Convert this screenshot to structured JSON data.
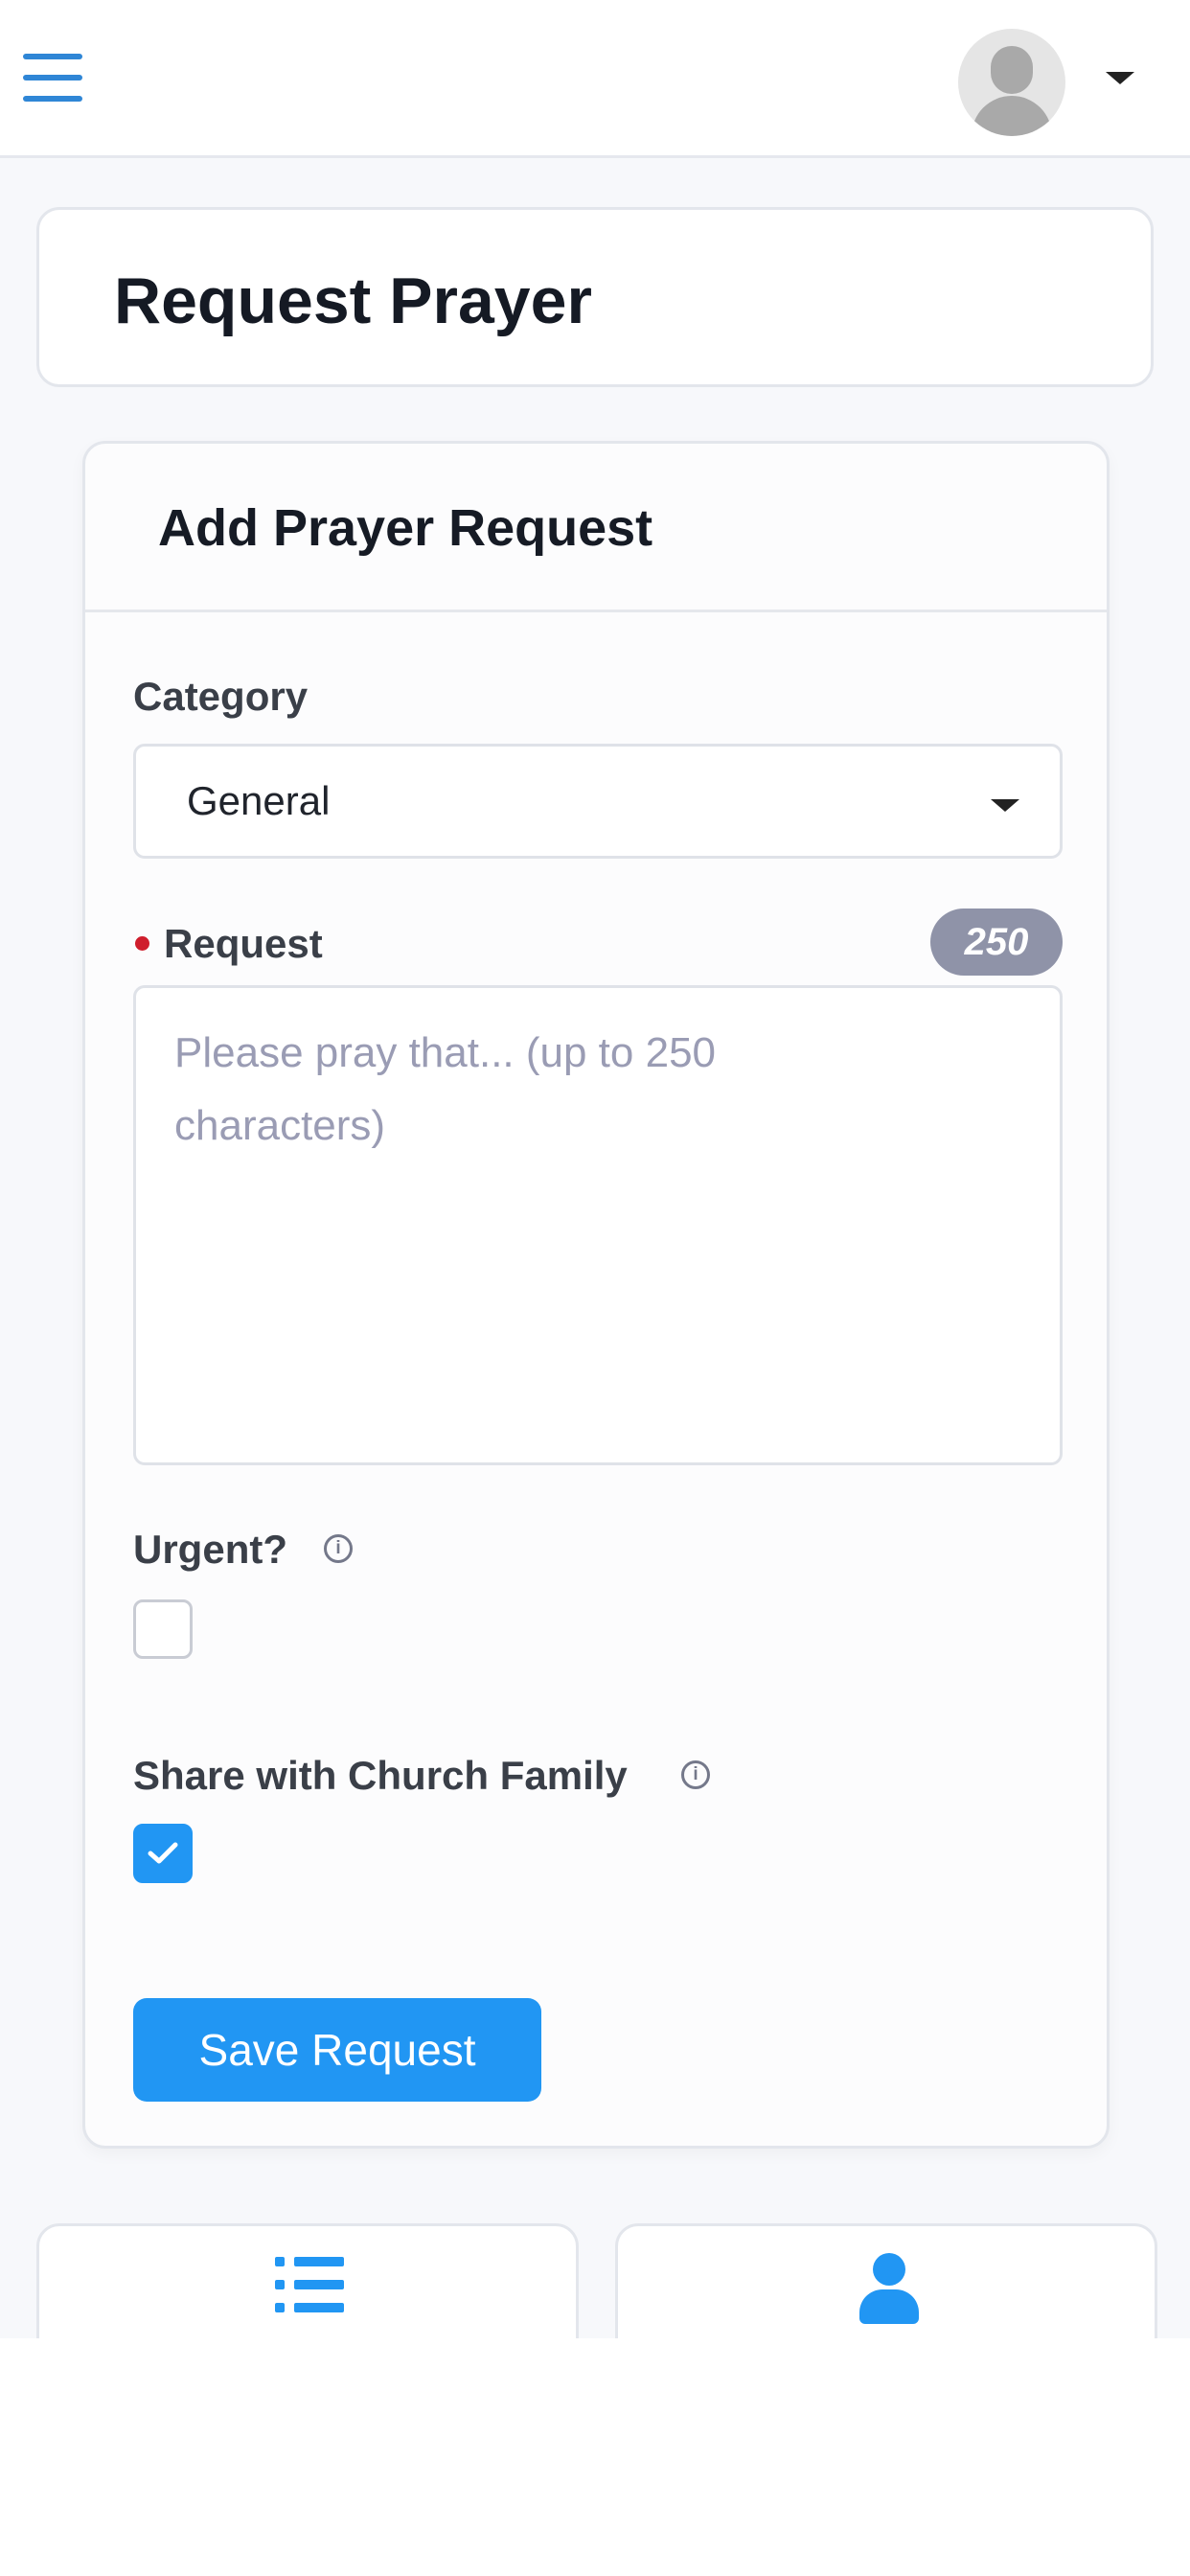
{
  "header": {
    "menu_icon": "hamburger-menu-icon",
    "avatar_icon": "user-avatar-icon",
    "dropdown_icon": "caret-down-icon"
  },
  "page": {
    "title": "Request Prayer"
  },
  "form": {
    "title": "Add Prayer Request",
    "category": {
      "label": "Category",
      "selected": "General"
    },
    "request": {
      "label": "Request",
      "required": true,
      "char_counter": "250",
      "placeholder": "Please pray that... (up to 250 characters)",
      "value": ""
    },
    "urgent": {
      "label": "Urgent?",
      "checked": false
    },
    "share": {
      "label": "Share with Church Family",
      "checked": true
    },
    "save_label": "Save Request"
  },
  "bottom_nav": {
    "items": [
      {
        "icon": "list-icon"
      },
      {
        "icon": "user-icon"
      }
    ]
  },
  "colors": {
    "accent": "#2196f3",
    "menu": "#2f86d6",
    "required_dot": "#cf1d2c",
    "counter_badge": "#8f93a8",
    "background": "#f7f8fb"
  }
}
